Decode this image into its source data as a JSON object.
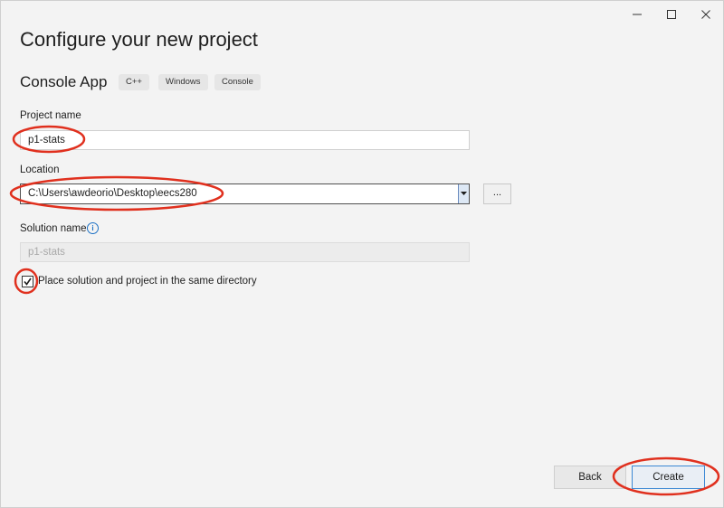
{
  "window": {
    "title": "Configure your new project",
    "controls": [
      "minimize-icon",
      "maximize-icon",
      "close-icon"
    ]
  },
  "template": {
    "name": "Console App",
    "tags": [
      "C++",
      "Windows",
      "Console"
    ]
  },
  "project_name": {
    "label": "Project name",
    "value": "p1-stats"
  },
  "location": {
    "label": "Location",
    "value": "C:\\Users\\awdeorio\\Desktop\\eecs280",
    "browse_label": "..."
  },
  "solution_name": {
    "label": "Solution name",
    "value": "p1-stats",
    "info_icon": "info-icon"
  },
  "same_directory": {
    "label": "Place solution and project in the same directory",
    "checked": true
  },
  "footer": {
    "back_label": "Back",
    "create_label": "Create"
  },
  "colors": {
    "annotation": "#e0301e",
    "accent": "#3b87d4",
    "background": "#f3f3f3"
  }
}
